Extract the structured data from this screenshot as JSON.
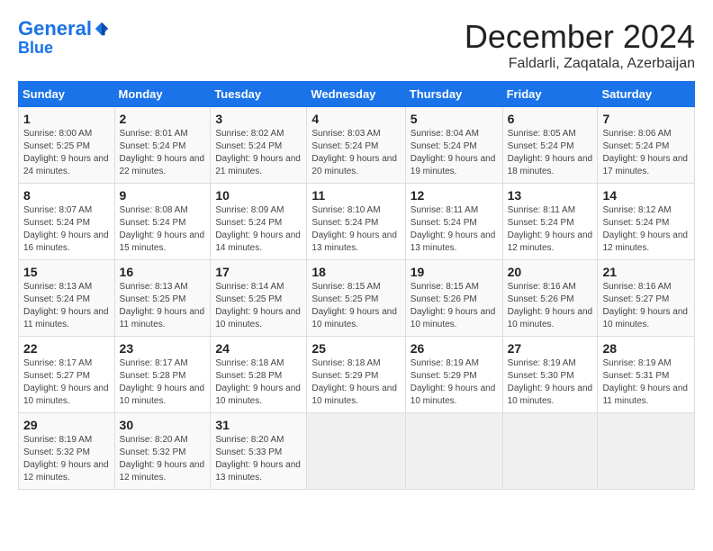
{
  "header": {
    "logo_line1": "General",
    "logo_line2": "Blue",
    "month": "December 2024",
    "location": "Faldarli, Zaqatala, Azerbaijan"
  },
  "weekdays": [
    "Sunday",
    "Monday",
    "Tuesday",
    "Wednesday",
    "Thursday",
    "Friday",
    "Saturday"
  ],
  "weeks": [
    [
      {
        "day": "1",
        "sunrise": "Sunrise: 8:00 AM",
        "sunset": "Sunset: 5:25 PM",
        "daylight": "Daylight: 9 hours and 24 minutes."
      },
      {
        "day": "2",
        "sunrise": "Sunrise: 8:01 AM",
        "sunset": "Sunset: 5:24 PM",
        "daylight": "Daylight: 9 hours and 22 minutes."
      },
      {
        "day": "3",
        "sunrise": "Sunrise: 8:02 AM",
        "sunset": "Sunset: 5:24 PM",
        "daylight": "Daylight: 9 hours and 21 minutes."
      },
      {
        "day": "4",
        "sunrise": "Sunrise: 8:03 AM",
        "sunset": "Sunset: 5:24 PM",
        "daylight": "Daylight: 9 hours and 20 minutes."
      },
      {
        "day": "5",
        "sunrise": "Sunrise: 8:04 AM",
        "sunset": "Sunset: 5:24 PM",
        "daylight": "Daylight: 9 hours and 19 minutes."
      },
      {
        "day": "6",
        "sunrise": "Sunrise: 8:05 AM",
        "sunset": "Sunset: 5:24 PM",
        "daylight": "Daylight: 9 hours and 18 minutes."
      },
      {
        "day": "7",
        "sunrise": "Sunrise: 8:06 AM",
        "sunset": "Sunset: 5:24 PM",
        "daylight": "Daylight: 9 hours and 17 minutes."
      }
    ],
    [
      {
        "day": "8",
        "sunrise": "Sunrise: 8:07 AM",
        "sunset": "Sunset: 5:24 PM",
        "daylight": "Daylight: 9 hours and 16 minutes."
      },
      {
        "day": "9",
        "sunrise": "Sunrise: 8:08 AM",
        "sunset": "Sunset: 5:24 PM",
        "daylight": "Daylight: 9 hours and 15 minutes."
      },
      {
        "day": "10",
        "sunrise": "Sunrise: 8:09 AM",
        "sunset": "Sunset: 5:24 PM",
        "daylight": "Daylight: 9 hours and 14 minutes."
      },
      {
        "day": "11",
        "sunrise": "Sunrise: 8:10 AM",
        "sunset": "Sunset: 5:24 PM",
        "daylight": "Daylight: 9 hours and 13 minutes."
      },
      {
        "day": "12",
        "sunrise": "Sunrise: 8:11 AM",
        "sunset": "Sunset: 5:24 PM",
        "daylight": "Daylight: 9 hours and 13 minutes."
      },
      {
        "day": "13",
        "sunrise": "Sunrise: 8:11 AM",
        "sunset": "Sunset: 5:24 PM",
        "daylight": "Daylight: 9 hours and 12 minutes."
      },
      {
        "day": "14",
        "sunrise": "Sunrise: 8:12 AM",
        "sunset": "Sunset: 5:24 PM",
        "daylight": "Daylight: 9 hours and 12 minutes."
      }
    ],
    [
      {
        "day": "15",
        "sunrise": "Sunrise: 8:13 AM",
        "sunset": "Sunset: 5:24 PM",
        "daylight": "Daylight: 9 hours and 11 minutes."
      },
      {
        "day": "16",
        "sunrise": "Sunrise: 8:13 AM",
        "sunset": "Sunset: 5:25 PM",
        "daylight": "Daylight: 9 hours and 11 minutes."
      },
      {
        "day": "17",
        "sunrise": "Sunrise: 8:14 AM",
        "sunset": "Sunset: 5:25 PM",
        "daylight": "Daylight: 9 hours and 10 minutes."
      },
      {
        "day": "18",
        "sunrise": "Sunrise: 8:15 AM",
        "sunset": "Sunset: 5:25 PM",
        "daylight": "Daylight: 9 hours and 10 minutes."
      },
      {
        "day": "19",
        "sunrise": "Sunrise: 8:15 AM",
        "sunset": "Sunset: 5:26 PM",
        "daylight": "Daylight: 9 hours and 10 minutes."
      },
      {
        "day": "20",
        "sunrise": "Sunrise: 8:16 AM",
        "sunset": "Sunset: 5:26 PM",
        "daylight": "Daylight: 9 hours and 10 minutes."
      },
      {
        "day": "21",
        "sunrise": "Sunrise: 8:16 AM",
        "sunset": "Sunset: 5:27 PM",
        "daylight": "Daylight: 9 hours and 10 minutes."
      }
    ],
    [
      {
        "day": "22",
        "sunrise": "Sunrise: 8:17 AM",
        "sunset": "Sunset: 5:27 PM",
        "daylight": "Daylight: 9 hours and 10 minutes."
      },
      {
        "day": "23",
        "sunrise": "Sunrise: 8:17 AM",
        "sunset": "Sunset: 5:28 PM",
        "daylight": "Daylight: 9 hours and 10 minutes."
      },
      {
        "day": "24",
        "sunrise": "Sunrise: 8:18 AM",
        "sunset": "Sunset: 5:28 PM",
        "daylight": "Daylight: 9 hours and 10 minutes."
      },
      {
        "day": "25",
        "sunrise": "Sunrise: 8:18 AM",
        "sunset": "Sunset: 5:29 PM",
        "daylight": "Daylight: 9 hours and 10 minutes."
      },
      {
        "day": "26",
        "sunrise": "Sunrise: 8:19 AM",
        "sunset": "Sunset: 5:29 PM",
        "daylight": "Daylight: 9 hours and 10 minutes."
      },
      {
        "day": "27",
        "sunrise": "Sunrise: 8:19 AM",
        "sunset": "Sunset: 5:30 PM",
        "daylight": "Daylight: 9 hours and 10 minutes."
      },
      {
        "day": "28",
        "sunrise": "Sunrise: 8:19 AM",
        "sunset": "Sunset: 5:31 PM",
        "daylight": "Daylight: 9 hours and 11 minutes."
      }
    ],
    [
      {
        "day": "29",
        "sunrise": "Sunrise: 8:19 AM",
        "sunset": "Sunset: 5:32 PM",
        "daylight": "Daylight: 9 hours and 12 minutes."
      },
      {
        "day": "30",
        "sunrise": "Sunrise: 8:20 AM",
        "sunset": "Sunset: 5:32 PM",
        "daylight": "Daylight: 9 hours and 12 minutes."
      },
      {
        "day": "31",
        "sunrise": "Sunrise: 8:20 AM",
        "sunset": "Sunset: 5:33 PM",
        "daylight": "Daylight: 9 hours and 13 minutes."
      },
      null,
      null,
      null,
      null
    ]
  ]
}
